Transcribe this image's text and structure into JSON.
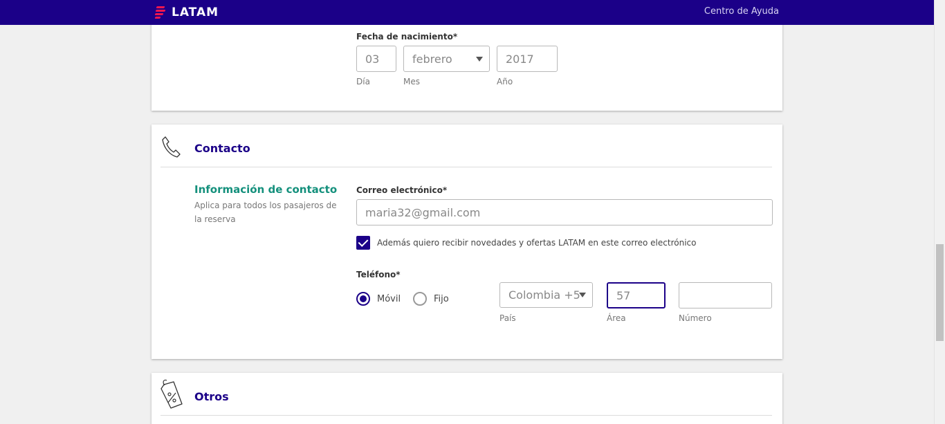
{
  "header": {
    "brand": "LATAM",
    "help_link": "Centro de Ayuda"
  },
  "birth": {
    "label": "Fecha de nacimiento*",
    "day_value": "03",
    "month_value": "febrero",
    "year_value": "2017",
    "day_sub": "Día",
    "month_sub": "Mes",
    "year_sub": "Año"
  },
  "contact": {
    "section_title": "Contacto",
    "info_title": "Información de contacto",
    "info_desc": "Aplica para todos los pasajeros de la reserva",
    "email_label": "Correo electrónico*",
    "email_value": "maria32@gmail.com",
    "newsletter_label": "Además quiero recibir novedades y ofertas LATAM en este correo electrónico",
    "newsletter_checked": true,
    "phone_label": "Teléfono*",
    "phone_type_mobile": "Móvil",
    "phone_type_landline": "Fijo",
    "country_value": "Colombia +5",
    "area_value": "57",
    "number_value": "",
    "country_sub": "País",
    "area_sub": "Área",
    "number_sub": "Número"
  },
  "others": {
    "section_title": "Otros"
  },
  "icons": {
    "phone": "phone-icon",
    "tag": "discount-tag-icon",
    "select": "chevron-down-icon"
  },
  "colors": {
    "brand": "#1b0088",
    "accent_green": "#14907c",
    "logo_red": "#ed1650"
  }
}
